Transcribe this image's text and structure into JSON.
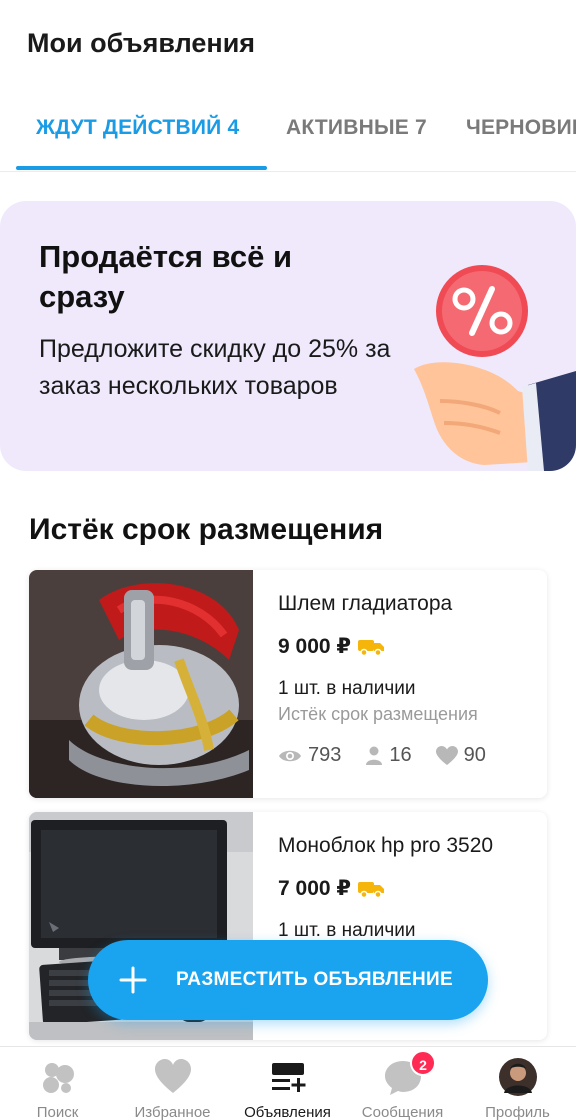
{
  "header": {
    "title": "Мои объявления",
    "tabs": [
      {
        "label": "ЖДУТ ДЕЙСТВИЙ 4",
        "active": true
      },
      {
        "label": "АКТИВНЫЕ 7",
        "active": false
      },
      {
        "label": "ЧЕРНОВИКИ",
        "active": false
      }
    ]
  },
  "banner": {
    "title": "Продаётся всё и сразу",
    "text": "Предложите скидку до 25% за заказ нескольких товаров",
    "icon": "percent-coin-hand-icon"
  },
  "section": {
    "title": "Истёк срок размещения"
  },
  "listings": [
    {
      "name": "Шлем гладиатора",
      "price": "9 000 ₽",
      "delivery_icon": "delivery-truck-icon",
      "stock": "1 шт. в наличии",
      "status": "Истёк срок размещения",
      "views": "793",
      "contacts": "16",
      "favorites": "90"
    },
    {
      "name": "Моноблок hp pro 3520",
      "price": "7 000 ₽",
      "delivery_icon": "delivery-truck-icon",
      "stock": "1 шт. в наличии"
    }
  ],
  "fab": {
    "label": "РАЗМЕСТИТЬ ОБЪЯВЛЕНИЕ"
  },
  "bottom_nav": {
    "items": [
      {
        "label": "Поиск",
        "icon": "search-dots-icon"
      },
      {
        "label": "Избранное",
        "icon": "heart-icon"
      },
      {
        "label": "Объявления",
        "icon": "listings-add-icon",
        "active": true
      },
      {
        "label": "Сообщения",
        "icon": "chat-bubble-icon",
        "badge": "2"
      },
      {
        "label": "Профиль",
        "icon": "avatar"
      }
    ]
  },
  "colors": {
    "accent": "#1a9be6",
    "fab": "#1aa3ee",
    "banner_bg": "#efe9fb",
    "badge": "#ff2b55",
    "delivery": "#f5b50a"
  }
}
